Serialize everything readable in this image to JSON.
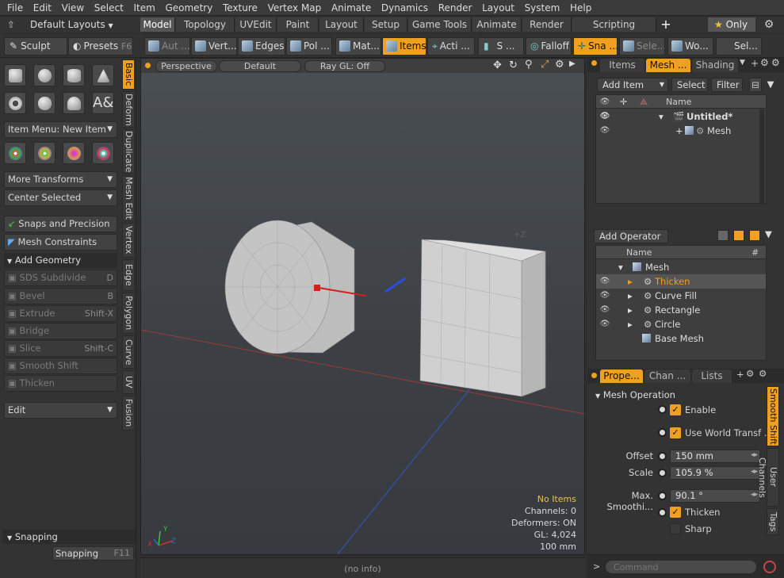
{
  "menu": [
    "File",
    "Edit",
    "View",
    "Select",
    "Item",
    "Geometry",
    "Texture",
    "Vertex Map",
    "Animate",
    "Dynamics",
    "Render",
    "Layout",
    "System",
    "Help"
  ],
  "layout_dropdown": "Default Layouts",
  "layout_tabs": [
    "Model",
    "Topology",
    "UVEdit",
    "Paint",
    "Layout",
    "Setup",
    "Game Tools",
    "Animate",
    "Render",
    "Scripting"
  ],
  "active_layout_tab": "Model",
  "only_label": "Only",
  "toolbar": {
    "sculpt": "Sculpt",
    "presets": "Presets",
    "presets_hotkey": "F6",
    "buttons": [
      "Aut ...",
      "Vert...",
      "Edges",
      "Pol ...",
      "Mat...",
      "Items",
      "Acti ...",
      "S ...",
      "Falloff",
      "Sna ...",
      "Sele...",
      "Wo...",
      "Sel..."
    ]
  },
  "left_panel": {
    "item_menu": "Item Menu: New Item",
    "more_transforms": "More Transforms",
    "center_selected": "Center Selected",
    "snaps_precision": "Snaps and Precision",
    "mesh_constraints": "Mesh Constraints",
    "add_geometry": "Add Geometry",
    "tools": [
      {
        "label": "SDS Subdivide",
        "hotkey": "D"
      },
      {
        "label": "Bevel",
        "hotkey": "B"
      },
      {
        "label": "Extrude",
        "hotkey": "Shift-X"
      },
      {
        "label": "Bridge",
        "hotkey": ""
      },
      {
        "label": "Slice",
        "hotkey": "Shift-C"
      },
      {
        "label": "Smooth Shift",
        "hotkey": ""
      },
      {
        "label": "Thicken",
        "hotkey": ""
      }
    ],
    "edit_dropdown": "Edit",
    "snapping_header": "Snapping",
    "snapping_button": "Snapping",
    "snapping_hotkey": "F11",
    "vertical_tabs": [
      "Basic",
      "Deform",
      "Duplicate",
      "Mesh Edit",
      "Vertex",
      "Edge",
      "Polygon",
      "Curve",
      "UV",
      "Fusion"
    ]
  },
  "viewport": {
    "view": "Perspective",
    "shading": "Default",
    "raygl": "Ray GL: Off",
    "axis_label": "+Z",
    "hud": {
      "selection": "No Items",
      "channels": "Channels: 0",
      "deformers": "Deformers: ON",
      "gl": "GL: 4,024",
      "grid": "100 mm"
    },
    "status": "(no info)"
  },
  "right_panel": {
    "tabs_top": [
      "Items",
      "Mesh ...",
      "Shading"
    ],
    "add_item": "Add Item",
    "select": "Select",
    "filter": "Filter",
    "name_col": "Name",
    "scene_items": [
      {
        "name": "Untitled*",
        "level": 0
      },
      {
        "name": "Mesh",
        "level": 1
      }
    ],
    "add_operator": "Add Operator",
    "op_name_col": "Name",
    "op_hash_col": "#",
    "operators": [
      {
        "name": "Mesh",
        "level": 0
      },
      {
        "name": "Thicken",
        "level": 1
      },
      {
        "name": "Curve Fill",
        "level": 1
      },
      {
        "name": "Rectangle",
        "level": 1
      },
      {
        "name": "Circle",
        "level": 1
      },
      {
        "name": "Base Mesh",
        "level": 1
      }
    ],
    "tabs_props": [
      "Prope...",
      "Chan ...",
      "Lists"
    ],
    "mesh_operation": "Mesh Operation",
    "enable": "Enable",
    "world_transform": "Use World Transf ...",
    "offset_label": "Offset",
    "offset_value": "150 mm",
    "scale_label": "Scale",
    "scale_value": "105.9 %",
    "max_smoothing_label": "Max. Smoothi...",
    "max_smoothing_value": "90.1 °",
    "thicken": "Thicken",
    "sharp": "Sharp",
    "vertical_tabs": [
      "Smooth Shift",
      "User Channels",
      "Tags"
    ],
    "command_placeholder": "Command"
  },
  "colors": {
    "accent": "#f0a020",
    "bg": "#333333",
    "viewport": "#44484c"
  }
}
